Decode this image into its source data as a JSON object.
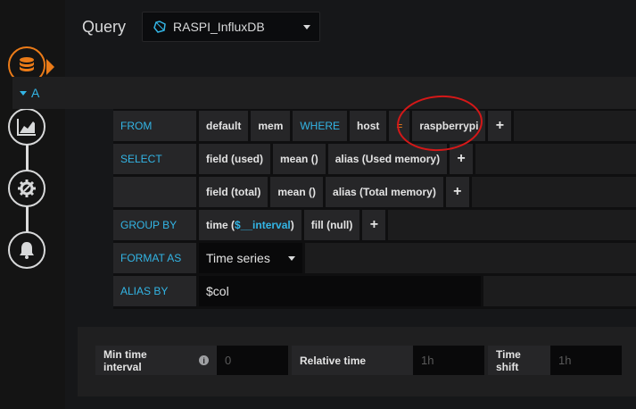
{
  "header": {
    "title": "Query",
    "datasource": "RASPI_InfluxDB"
  },
  "rail": {
    "items": [
      "database-icon",
      "chart-area-icon",
      "gear-icon",
      "bell-icon"
    ]
  },
  "query": {
    "ref_id": "A",
    "from": {
      "label": "FROM",
      "policy": "default",
      "measurement": "mem",
      "where_label": "WHERE",
      "tag_key": "host",
      "operator": "=",
      "tag_value": "raspberrypi",
      "add": "+"
    },
    "select": {
      "label": "SELECT",
      "rows": [
        {
          "field": "field (used)",
          "fn": "mean ()",
          "alias": "alias (Used memory)",
          "add": "+"
        },
        {
          "field": "field (total)",
          "fn": "mean ()",
          "alias": "alias (Total memory)",
          "add": "+"
        }
      ]
    },
    "group_by": {
      "label": "GROUP BY",
      "time_prefix": "time (",
      "time_var": "$__interval",
      "time_suffix": ")",
      "fill": "fill (null)",
      "add": "+"
    },
    "format_as": {
      "label": "FORMAT AS",
      "value": "Time series"
    },
    "alias_by": {
      "label": "ALIAS BY",
      "value": "$col"
    }
  },
  "options": {
    "min_interval": {
      "label": "Min time interval",
      "placeholder": "0"
    },
    "relative_time": {
      "label": "Relative time",
      "placeholder": "1h"
    },
    "time_shift": {
      "label": "Time shift",
      "placeholder": "1h"
    }
  },
  "colors": {
    "accent_blue": "#33b5e5",
    "accent_orange": "#eb7b18",
    "annotation_red": "#d41818"
  }
}
